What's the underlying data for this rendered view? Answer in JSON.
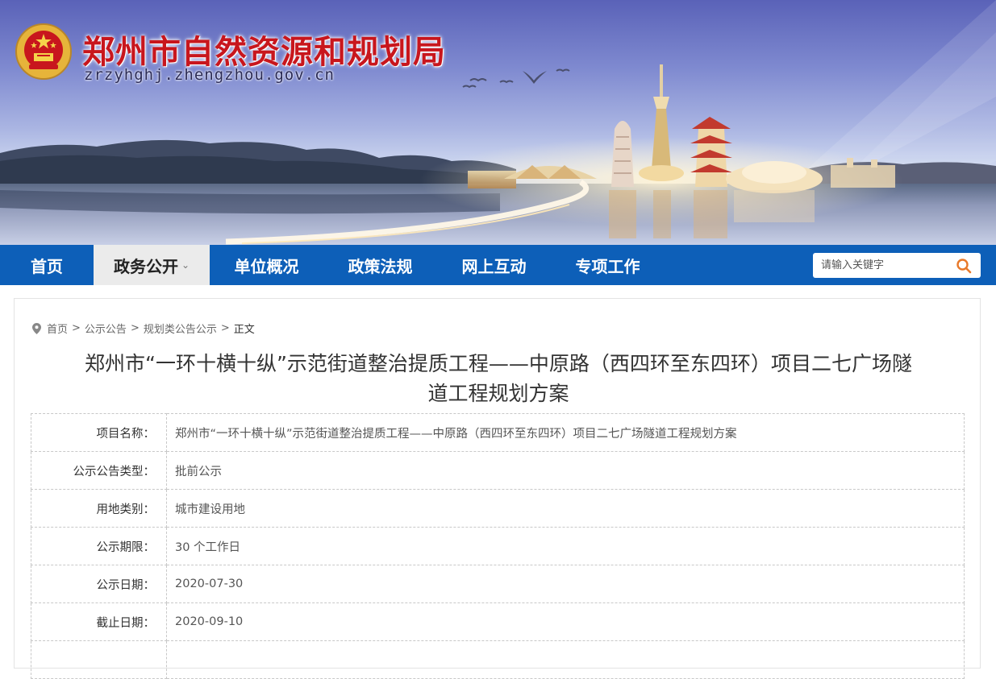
{
  "header": {
    "site_title": "郑州市自然资源和规划局",
    "domain": "zrzyhghj.zhengzhou.gov.cn"
  },
  "nav": {
    "items": [
      {
        "label": "首页"
      },
      {
        "label": "政务公开",
        "active": true
      },
      {
        "label": "单位概况"
      },
      {
        "label": "政策法规"
      },
      {
        "label": "网上互动"
      },
      {
        "label": "专项工作"
      }
    ],
    "search_placeholder": "请输入关键字"
  },
  "breadcrumb": [
    "首页",
    "公示公告",
    "规划类公告公示",
    "正文"
  ],
  "article": {
    "title_line1": "郑州市“一环十横十纵”示范街道整治提质工程——中原路（西四环至东四环）项目二七广场隧",
    "title_line2": "道工程规划方案",
    "rows": [
      {
        "label": "项目名称：",
        "value": "郑州市“一环十横十纵”示范街道整治提质工程——中原路（西四环至东四环）项目二七广场隧道工程规划方案"
      },
      {
        "label": "公示公告类型：",
        "value": "批前公示"
      },
      {
        "label": "用地类别：",
        "value": "城市建设用地"
      },
      {
        "label": "公示期限：",
        "value": "30 个工作日"
      },
      {
        "label": "公示日期：",
        "value": "2020-07-30"
      },
      {
        "label": "截止日期：",
        "value": "2020-09-10"
      },
      {
        "label": "",
        "value": ""
      }
    ]
  },
  "colors": {
    "nav_blue": "#0d5fb8",
    "title_red": "#c8161d",
    "search_icon": "#e8792a"
  },
  "icons": {
    "emblem": "national-emblem",
    "search": "search-icon",
    "location": "location-pin-icon",
    "dropdown": "chevron-down-icon"
  }
}
